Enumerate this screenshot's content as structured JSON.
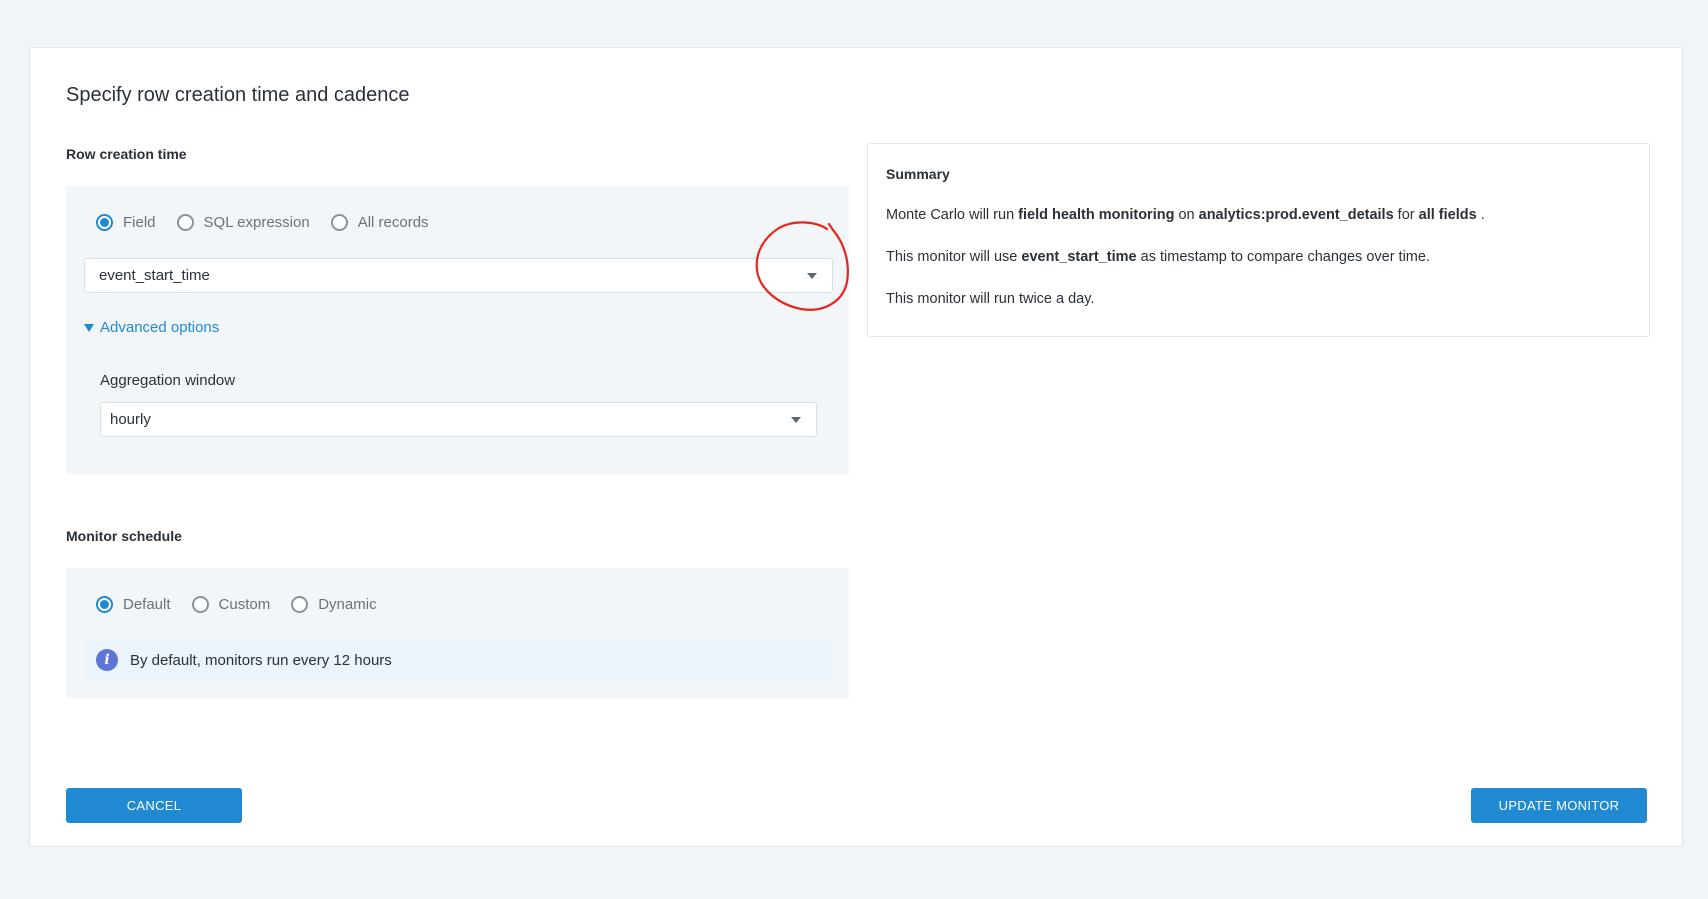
{
  "page": {
    "title": "Specify row creation time and cadence"
  },
  "row_creation": {
    "label": "Row creation time",
    "radios": [
      {
        "label": "Field",
        "checked": true
      },
      {
        "label": "SQL expression",
        "checked": false
      },
      {
        "label": "All records",
        "checked": false
      }
    ],
    "field_select_value": "event_start_time",
    "advanced_options_label": "Advanced options",
    "aggregation_label": "Aggregation window",
    "aggregation_value": "hourly"
  },
  "schedule": {
    "label": "Monitor schedule",
    "radios": [
      {
        "label": "Default",
        "checked": true
      },
      {
        "label": "Custom",
        "checked": false
      },
      {
        "label": "Dynamic",
        "checked": false
      }
    ],
    "info_icon_glyph": "i",
    "info_text": "By default, monitors run every 12 hours"
  },
  "summary": {
    "title": "Summary",
    "line1": {
      "p1": "Monte Carlo will run ",
      "b1": "field health monitoring",
      "p2": " on ",
      "b2": "analytics:prod.event_details",
      "p3": " for ",
      "b3": "all fields",
      "p4": " ."
    },
    "line2": {
      "p1": "This monitor will use ",
      "b1": "event_start_time",
      "p2": " as timestamp to compare changes over time."
    },
    "line3": "This monitor will run twice a day."
  },
  "buttons": {
    "cancel": "CANCEL",
    "update": "UPDATE MONITOR"
  },
  "colors": {
    "accent": "#1f8ad1",
    "annotation": "#e8251c",
    "info_icon": "#5d76d6"
  }
}
